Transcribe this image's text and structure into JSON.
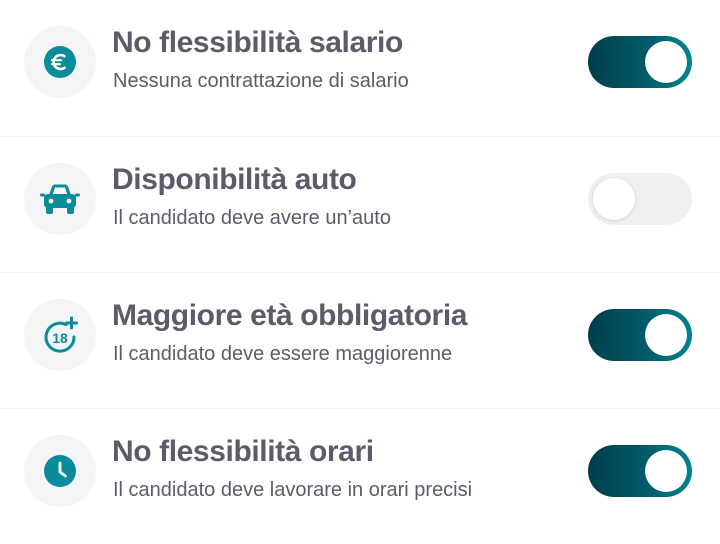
{
  "colors": {
    "accent": "#0a8c9b",
    "toggle_on": "#015a68",
    "toggle_off": "#eeeff1",
    "text": "#5d5b69"
  },
  "settings": [
    {
      "icon": "euro-icon",
      "title": "No flessibilità salario",
      "subtitle": "Nessuna contrattazione di salario",
      "enabled": true
    },
    {
      "icon": "car-icon",
      "title": "Disponibilità auto",
      "subtitle": "Il candidato deve avere un’auto",
      "enabled": false
    },
    {
      "icon": "age-18-plus-icon",
      "title": "Maggiore età obbligatoria",
      "subtitle": "Il candidato deve essere maggiorenne",
      "enabled": true
    },
    {
      "icon": "clock-icon",
      "title": "No flessibilità orari",
      "subtitle": "Il candidato deve lavorare in orari precisi",
      "enabled": true
    }
  ]
}
